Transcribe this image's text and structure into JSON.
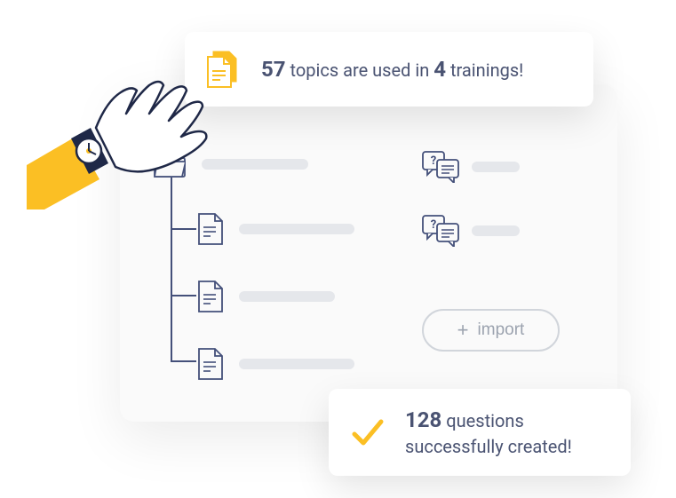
{
  "topBanner": {
    "count": "57",
    "mid1": "topics are used in",
    "count2": "4",
    "mid2": "trainings!"
  },
  "importButton": {
    "label": "import"
  },
  "bottomBanner": {
    "count": "128",
    "line1": "questions",
    "line2": "successfully created!"
  },
  "colors": {
    "accent": "#fbbf24",
    "muted": "#6b7280",
    "line": "#44507a"
  }
}
